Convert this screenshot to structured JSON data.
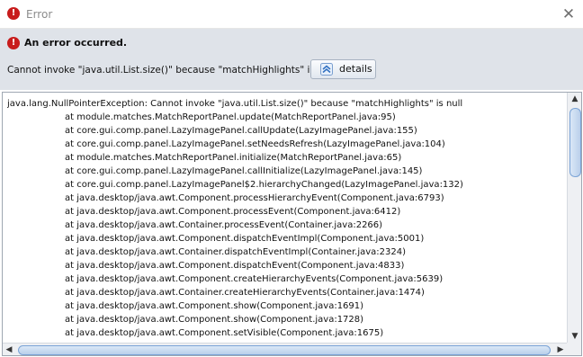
{
  "window": {
    "title": "Error",
    "close_glyph": "✕"
  },
  "header": {
    "title": "An error occurred.",
    "message": "Cannot invoke \"java.util.List.size()\" because \"matchHighlights\" is null",
    "details_label": "details",
    "error_icon_glyph": "!"
  },
  "trace": {
    "lines": [
      "java.lang.NullPointerException: Cannot invoke \"java.util.List.size()\" because \"matchHighlights\" is null",
      "at module.matches.MatchReportPanel.update(MatchReportPanel.java:95)",
      "at core.gui.comp.panel.LazyImagePanel.callUpdate(LazyImagePanel.java:155)",
      "at core.gui.comp.panel.LazyImagePanel.setNeedsRefresh(LazyImagePanel.java:104)",
      "at module.matches.MatchReportPanel.initialize(MatchReportPanel.java:65)",
      "at core.gui.comp.panel.LazyImagePanel.callInitialize(LazyImagePanel.java:145)",
      "at core.gui.comp.panel.LazyImagePanel$2.hierarchyChanged(LazyImagePanel.java:132)",
      "at java.desktop/java.awt.Component.processHierarchyEvent(Component.java:6793)",
      "at java.desktop/java.awt.Component.processEvent(Component.java:6412)",
      "at java.desktop/java.awt.Container.processEvent(Container.java:2266)",
      "at java.desktop/java.awt.Component.dispatchEventImpl(Component.java:5001)",
      "at java.desktop/java.awt.Container.dispatchEventImpl(Container.java:2324)",
      "at java.desktop/java.awt.Component.dispatchEvent(Component.java:4833)",
      "at java.desktop/java.awt.Component.createHierarchyEvents(Component.java:5639)",
      "at java.desktop/java.awt.Container.createHierarchyEvents(Container.java:1474)",
      "at java.desktop/java.awt.Component.show(Component.java:1691)",
      "at java.desktop/java.awt.Component.show(Component.java:1728)",
      "at java.desktop/java.awt.Component.setVisible(Component.java:1675)"
    ]
  },
  "icons": {
    "title": "error-icon",
    "header": "error-icon",
    "details": "collapse-up-icon",
    "close": "close-icon"
  },
  "colors": {
    "error_red": "#c81c1c",
    "header_bg": "#dfe3e9",
    "scroll_thumb": "#b9cfea"
  }
}
